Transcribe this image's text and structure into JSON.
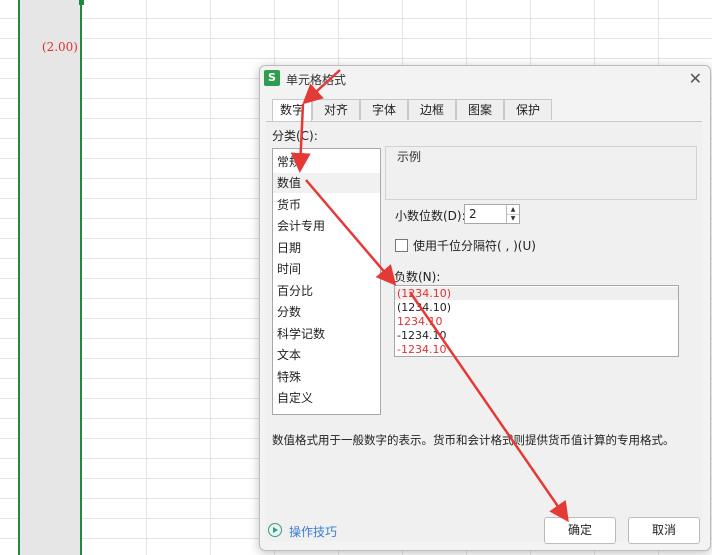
{
  "sheet": {
    "cell_value": "(2.00)"
  },
  "dialog": {
    "title": "单元格格式",
    "app_icon": "S",
    "tabs": [
      "数字",
      "对齐",
      "字体",
      "边框",
      "图案",
      "保护"
    ],
    "active_tab": "数字",
    "category_label": "分类(C):",
    "categories": [
      "常规",
      "数值",
      "货币",
      "会计专用",
      "日期",
      "时间",
      "百分比",
      "分数",
      "科学记数",
      "文本",
      "特殊",
      "自定义"
    ],
    "selected_category": "数值",
    "sample_label": "示例",
    "decimal_label": "小数位数(D):",
    "decimal_value": "2",
    "thousands_label": "使用千位分隔符( , )(U)",
    "negative_label": "负数(N):",
    "negative_options": [
      {
        "text": "(1234.10)",
        "color": "#e03131"
      },
      {
        "text": "(1234.10)",
        "color": "#222222"
      },
      {
        "text": "1234.10",
        "color": "#e03131"
      },
      {
        "text": "-1234.10",
        "color": "#222222"
      },
      {
        "text": "-1234.10",
        "color": "#e03131"
      }
    ],
    "description": "数值格式用于一般数字的表示。货币和会计格式则提供货币值计算的专用格式。",
    "help_label": "操作技巧",
    "ok_label": "确定",
    "cancel_label": "取消"
  },
  "colors": {
    "accent_green": "#1e8a3c",
    "annotation_red": "#e53935",
    "link_blue": "#3a7bd5"
  }
}
